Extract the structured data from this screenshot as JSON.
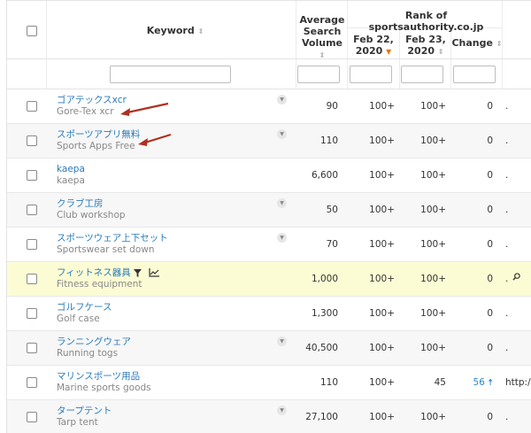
{
  "header": {
    "keyword_label": "Keyword",
    "volume_label_1": "Average",
    "volume_label_2": "Search",
    "volume_label_3": "Volume",
    "rank_group_label": "Rank of sportsauthority.co.jp",
    "date1_label_1": "Feb 22,",
    "date1_label_2": "2020",
    "date2_label_1": "Feb 23,",
    "date2_label_2": "2020",
    "change_label": "Change",
    "sort_icon": "⇕",
    "sort_desc_icon": "▼"
  },
  "rows": [
    {
      "keyword": "ゴアテックスxcr",
      "translation": "Gore-Tex xcr",
      "volume": "90",
      "rank1": "100+",
      "rank2": "100+",
      "change": "0",
      "url": "."
    },
    {
      "keyword": "スポーツアプリ無料",
      "translation": "Sports Apps Free",
      "volume": "110",
      "rank1": "100+",
      "rank2": "100+",
      "change": "0",
      "url": "."
    },
    {
      "keyword": "kaepa",
      "translation": "kaepa",
      "volume": "6,600",
      "rank1": "100+",
      "rank2": "100+",
      "change": "0",
      "url": "."
    },
    {
      "keyword": "クラブ工房",
      "translation": "Club workshop",
      "volume": "50",
      "rank1": "100+",
      "rank2": "100+",
      "change": "0",
      "url": "."
    },
    {
      "keyword": "スポーツウェア上下セット",
      "translation": "Sportswear set down",
      "volume": "70",
      "rank1": "100+",
      "rank2": "100+",
      "change": "0",
      "url": "."
    },
    {
      "keyword": "フィットネス器具",
      "translation": "Fitness equipment",
      "volume": "1,000",
      "rank1": "100+",
      "rank2": "100+",
      "change": "0",
      "url": "."
    },
    {
      "keyword": "ゴルフケース",
      "translation": "Golf case",
      "volume": "1,300",
      "rank1": "100+",
      "rank2": "100+",
      "change": "0",
      "url": "."
    },
    {
      "keyword": "ランニングウェア",
      "translation": "Running togs",
      "volume": "40,500",
      "rank1": "100+",
      "rank2": "100+",
      "change": "0",
      "url": "."
    },
    {
      "keyword": "マリンスポーツ用品",
      "translation": "Marine sports goods",
      "volume": "110",
      "rank1": "100+",
      "rank2": "45",
      "change": "56",
      "change_icon": "🠅",
      "url": "http:/"
    },
    {
      "keyword": "タープテント",
      "translation": "Tarp tent",
      "volume": "27,100",
      "rank1": "100+",
      "rank2": "100+",
      "change": "0",
      "url": "."
    }
  ],
  "colors": {
    "link": "#2a7ab8",
    "highlight_row": "#fcfcd4",
    "arrow": "#b03020",
    "sort_active": "#e07b20"
  }
}
